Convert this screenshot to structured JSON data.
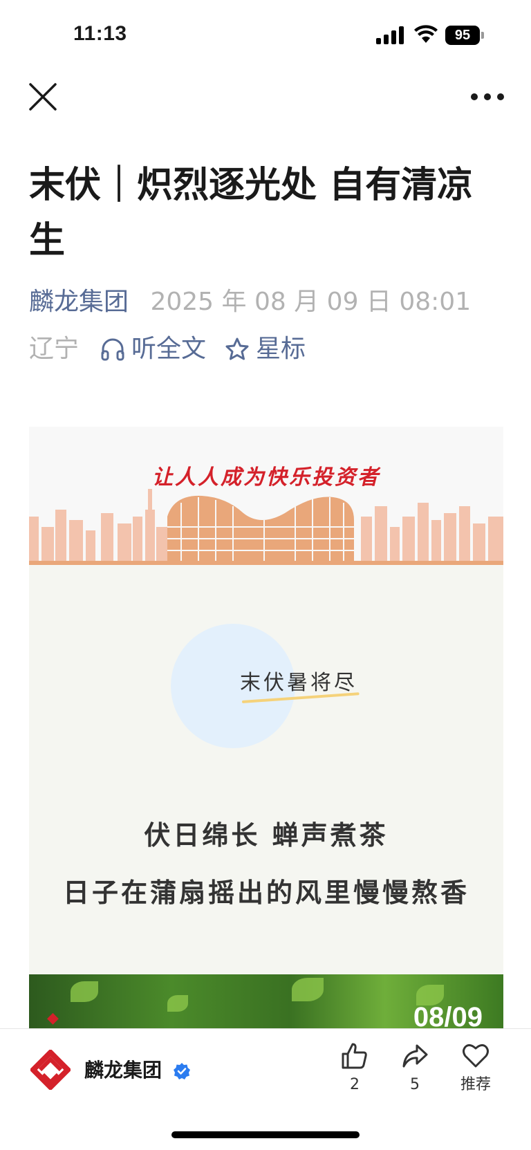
{
  "status_bar": {
    "time": "11:13",
    "battery": "95"
  },
  "nav": {
    "close_icon": "close-icon",
    "more_icon": "more-icon"
  },
  "article": {
    "title": "末伏｜炽烈逐光处 自有清凉生",
    "account": "麟龙集团",
    "publish_time": "2025 年 08 月 09 日 08:01",
    "region": "辽宁",
    "listen_label": "听全文",
    "star_label": "星标"
  },
  "poster": {
    "slogan": "让人人成为快乐投资者",
    "subtitle": "末伏暑将尽",
    "line1": "伏日绵长 蝉声煮茶",
    "line2": "日子在蒲扇摇出的风里慢慢熬香",
    "photo_date": "08/09"
  },
  "bottom_bar": {
    "account_name": "麟龙集团",
    "like_count": "2",
    "share_count": "5",
    "recommend_label": "推荐"
  },
  "colors": {
    "link": "#576b95",
    "meta_gray": "#b2b2b2",
    "brand_red": "#d4212a"
  }
}
